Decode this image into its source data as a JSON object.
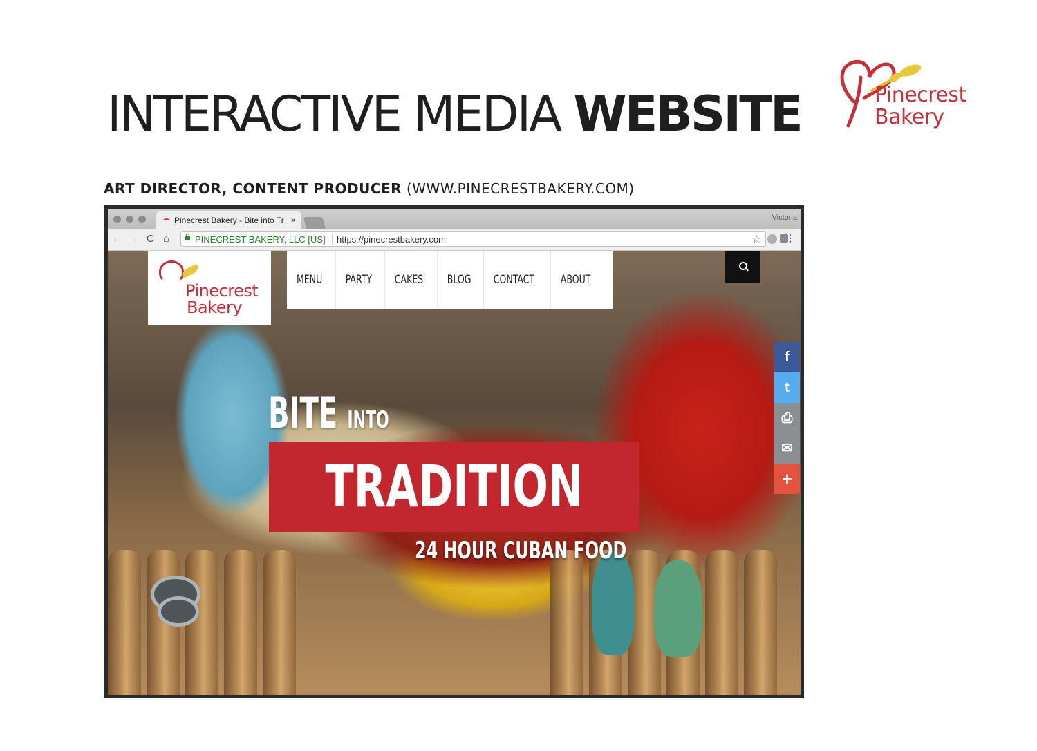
{
  "slide": {
    "title_light": "INTERACTIVE MEDIA ",
    "title_bold": "WEBSITE",
    "logo_line1": "Pinecrest",
    "logo_line2": "Bakery",
    "credit_role": "ART DIRECTOR, CONTENT PRODUCER",
    "credit_url": " (WWW.PINECRESTBAKERY.COM)"
  },
  "browser": {
    "tab_title": "Pinecrest Bakery - Bite into Tr",
    "tab_close": "×",
    "profile": "Victoria",
    "ev_label": "PINECREST BAKERY, LLC [US]",
    "url": "https://pinecrestbakery.com",
    "back_icon": "←",
    "forward_icon": "→",
    "reload_icon": "C",
    "home_icon": "⌂",
    "star_icon": "☆",
    "menu_icon": "⋮"
  },
  "site": {
    "logo_line1": "Pinecrest",
    "logo_line2": "Bakery",
    "nav": [
      "MENU",
      "PARTY",
      "CAKES",
      "BLOG",
      "CONTACT",
      "ABOUT"
    ],
    "hero": {
      "bite": "BITE",
      "into": "INTO",
      "tradition": "TRADITION",
      "subtitle": "24 HOUR CUBAN FOOD"
    },
    "social": {
      "facebook": "f",
      "twitter": "t",
      "print": "⎙",
      "email": "✉",
      "more": "+"
    }
  },
  "colors": {
    "brand_red": "#c4313b",
    "banner_red": "#c1272d",
    "facebook": "#3b5998",
    "twitter": "#55acee",
    "more": "#e2543e"
  }
}
